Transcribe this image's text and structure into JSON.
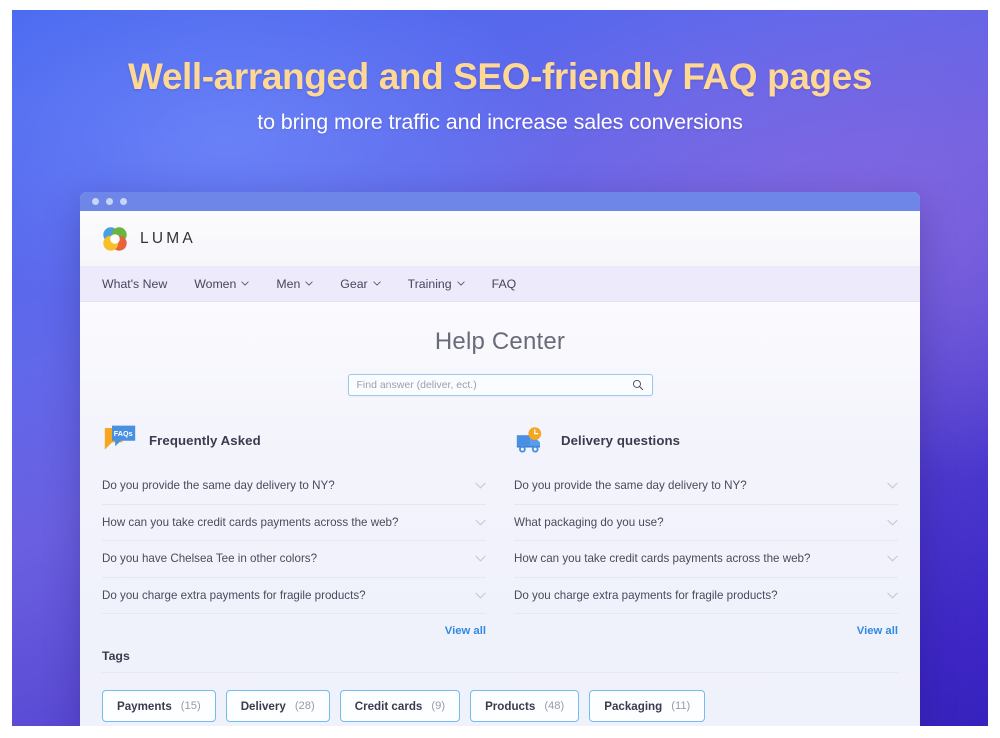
{
  "hero": {
    "headline": "Well-arranged and SEO-friendly FAQ pages",
    "subheadline": "to bring more traffic and increase sales conversions",
    "headline_color": "#ffd894",
    "gradient_from": "#4a6af0",
    "gradient_to": "#3722bd"
  },
  "browser": {
    "titlebar_color": "#6e86e8"
  },
  "site": {
    "logo_text": "LUMA",
    "logo_icon": "luma-ring-logo",
    "nav": [
      {
        "label": "What's New",
        "has_dropdown": false
      },
      {
        "label": "Women",
        "has_dropdown": true
      },
      {
        "label": "Men",
        "has_dropdown": true
      },
      {
        "label": "Gear",
        "has_dropdown": true
      },
      {
        "label": "Training",
        "has_dropdown": true
      },
      {
        "label": "FAQ",
        "has_dropdown": false
      }
    ]
  },
  "page": {
    "title": "Help Center"
  },
  "search": {
    "placeholder": "Find answer (deliver, ect.)",
    "value": "",
    "icon": "search-icon"
  },
  "columns": [
    {
      "title": "Frequently Asked",
      "icon": "faqs-speech-bubble-icon",
      "view_all_label": "View all",
      "questions": [
        "Do you provide the same day delivery to NY?",
        "How can you take credit cards payments across the web?",
        "Do you have Chelsea Tee in other colors?",
        "Do you charge extra payments for fragile products?"
      ]
    },
    {
      "title": "Delivery questions",
      "icon": "delivery-truck-clock-icon",
      "view_all_label": "View all",
      "questions": [
        "Do you provide the same day delivery to NY?",
        "What packaging do you use?",
        "How can you take credit cards payments across the web?",
        "Do you charge extra payments for fragile products?"
      ]
    }
  ],
  "tags": {
    "label": "Tags",
    "items": [
      {
        "name": "Payments",
        "count": "(15)"
      },
      {
        "name": "Delivery",
        "count": "(28)"
      },
      {
        "name": "Credit cards",
        "count": "(9)"
      },
      {
        "name": "Products",
        "count": "(48)"
      },
      {
        "name": "Packaging",
        "count": "(11)"
      }
    ],
    "border_color": "#74bced"
  },
  "link_color": "#2f8ae0"
}
